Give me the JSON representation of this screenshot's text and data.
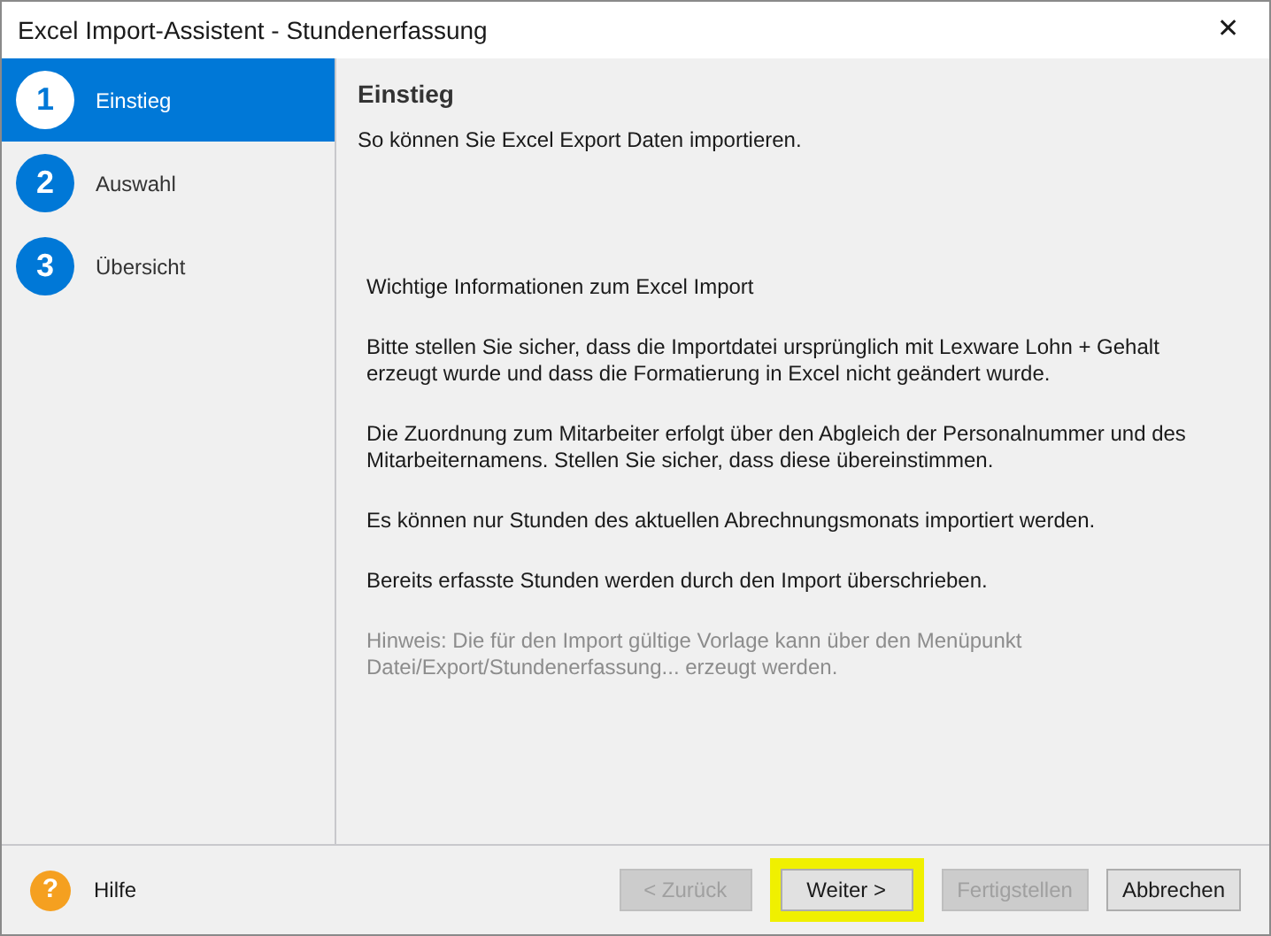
{
  "window": {
    "title": "Excel Import-Assistent - Stundenerfassung",
    "close": "✕"
  },
  "steps": [
    {
      "number": "1",
      "label": "Einstieg",
      "selected": true
    },
    {
      "number": "2",
      "label": "Auswahl",
      "selected": false
    },
    {
      "number": "3",
      "label": "Übersicht",
      "selected": false
    }
  ],
  "header": {
    "title": "Einstieg",
    "subtitle": "So können Sie Excel Export Daten importieren."
  },
  "paragraphs": [
    {
      "kind": "normal",
      "text": "Wichtige Informationen zum Excel Import"
    },
    {
      "kind": "normal",
      "text": "Bitte stellen Sie sicher, dass die Importdatei ursprünglich mit Lexware Lohn + Gehalt erzeugt wurde und dass die Formatierung in Excel nicht geändert wurde."
    },
    {
      "kind": "normal",
      "text": "Die Zuordnung zum Mitarbeiter erfolgt über den Abgleich der Personalnummer und des Mitarbeiternamens. Stellen Sie sicher, dass diese übereinstimmen."
    },
    {
      "kind": "normal",
      "text": "Es können nur Stunden des aktuellen Abrechnungsmonats importiert werden."
    },
    {
      "kind": "normal",
      "text": "Bereits erfasste Stunden werden durch den Import überschrieben."
    },
    {
      "kind": "hint",
      "text": "Hinweis: Die für den Import gültige Vorlage kann über den Menüpunkt Datei/Export/Stundenerfassung... erzeugt werden."
    }
  ],
  "help": {
    "icon": "?",
    "label": "Hilfe"
  },
  "buttons": [
    {
      "label": "< Zurück",
      "disabled": true,
      "highlighted": false
    },
    {
      "label": "Weiter >",
      "disabled": false,
      "highlighted": true
    },
    {
      "label": "Fertigstellen",
      "disabled": true,
      "highlighted": false
    },
    {
      "label": "Abbrechen",
      "disabled": false,
      "highlighted": false
    }
  ]
}
